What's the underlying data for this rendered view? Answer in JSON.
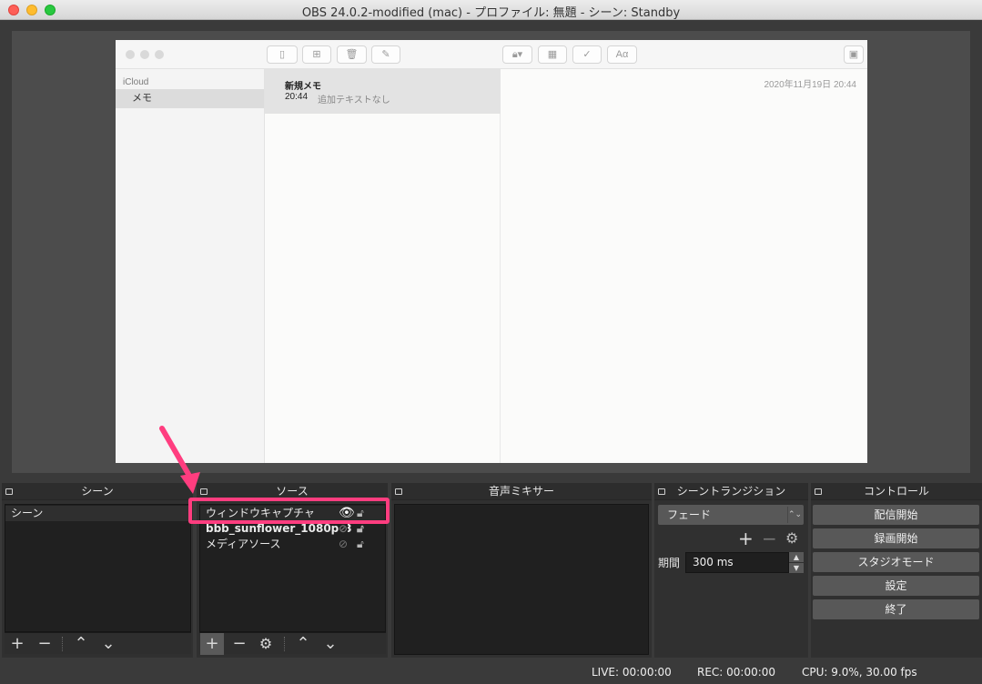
{
  "window": {
    "title": "OBS 24.0.2-modified (mac) - プロファイル: 無題 - シーン: Standby"
  },
  "notes_app": {
    "toolbar_icons": [
      "sidebar-icon",
      "grid-icon",
      "trash-icon",
      "compose-icon",
      "lock-icon",
      "table-icon",
      "checklist-icon",
      "format-icon",
      "media-icon"
    ],
    "format_label": "Aα",
    "account": "iCloud",
    "folder": "メモ",
    "note": {
      "title": "新規メモ",
      "time": "20:44",
      "preview": "追加テキストなし"
    },
    "date": "2020年11月19日 20:44"
  },
  "panels": {
    "scenes": {
      "title": "シーン",
      "items": [
        "シーン"
      ]
    },
    "sources": {
      "title": "ソース",
      "items": [
        {
          "name": "ウィンドウキャプチャ",
          "visible": true,
          "locked": false
        },
        {
          "name": "bbb_sunflower_1080p_3",
          "visible": false,
          "locked": false
        },
        {
          "name": "メディアソース",
          "visible": false,
          "locked": false
        }
      ]
    },
    "mixer": {
      "title": "音声ミキサー"
    },
    "transitions": {
      "title": "シーントランジション",
      "selected": "フェード",
      "duration_label": "期間",
      "duration_value": "300 ms"
    },
    "controls": {
      "title": "コントロール",
      "buttons": [
        "配信開始",
        "録画開始",
        "スタジオモード",
        "設定",
        "終了"
      ]
    }
  },
  "status": {
    "live": "LIVE: 00:00:00",
    "rec": "REC: 00:00:00",
    "cpu": "CPU: 9.0%, 30.00 fps"
  },
  "colors": {
    "highlight": "#ff3d7f",
    "background": "#3a3a3a",
    "panel": "#303030"
  }
}
